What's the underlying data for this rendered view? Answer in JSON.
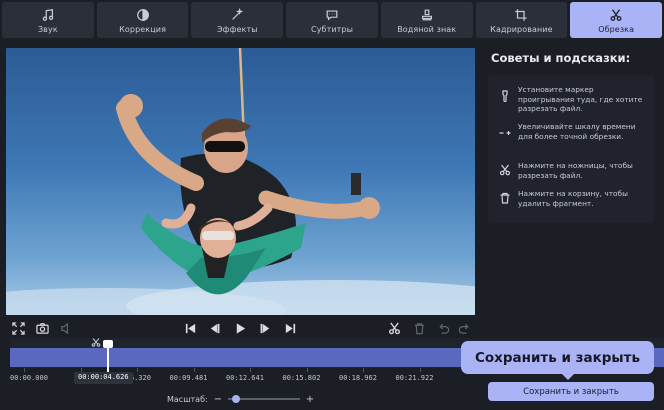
{
  "tabs": [
    {
      "label": "Звук",
      "icon": "music-note-icon"
    },
    {
      "label": "Коррекция",
      "icon": "contrast-icon"
    },
    {
      "label": "Эффекты",
      "icon": "magic-wand-icon"
    },
    {
      "label": "Субтитры",
      "icon": "speech-bubble-icon"
    },
    {
      "label": "Водяной знак",
      "icon": "stamp-icon"
    },
    {
      "label": "Кадрирование",
      "icon": "crop-icon"
    },
    {
      "label": "Обрезка",
      "icon": "scissors-icon",
      "active": true
    }
  ],
  "tips": {
    "title": "Советы и подсказки:",
    "items": [
      {
        "icon": "marker-pin-icon",
        "text": "Установите маркер проигрывания туда, где хотите разрезать файл."
      },
      {
        "icon": "zoom-scale-icon",
        "text": "Увеличивайте шкалу времени для более точной обрезки."
      },
      {
        "icon": "scissors-icon",
        "text": "Нажмите на ножницы, чтобы разрезать файл."
      },
      {
        "icon": "trash-icon",
        "text": "Нажмите на корзину, чтобы удалить фрагмент."
      }
    ]
  },
  "timeline": {
    "current_time": "00:00:04.626",
    "tick_labels": [
      "00:00.000",
      "00:03.160",
      "00:06.320",
      "00:09.481",
      "00:12.641",
      "00:15.802",
      "00:18.962",
      "00:21.922"
    ],
    "playhead_fraction": 0.148
  },
  "zoom": {
    "label": "Масштаб:",
    "minus": "−",
    "plus": "+",
    "level": 0.05
  },
  "save": {
    "tooltip": "Сохранить и закрыть",
    "button": "Сохранить и закрыть"
  },
  "colors": {
    "accent": "#a9b3f5",
    "track": "#5b68c0",
    "background": "#1b1e25",
    "panel": "#20232b"
  }
}
